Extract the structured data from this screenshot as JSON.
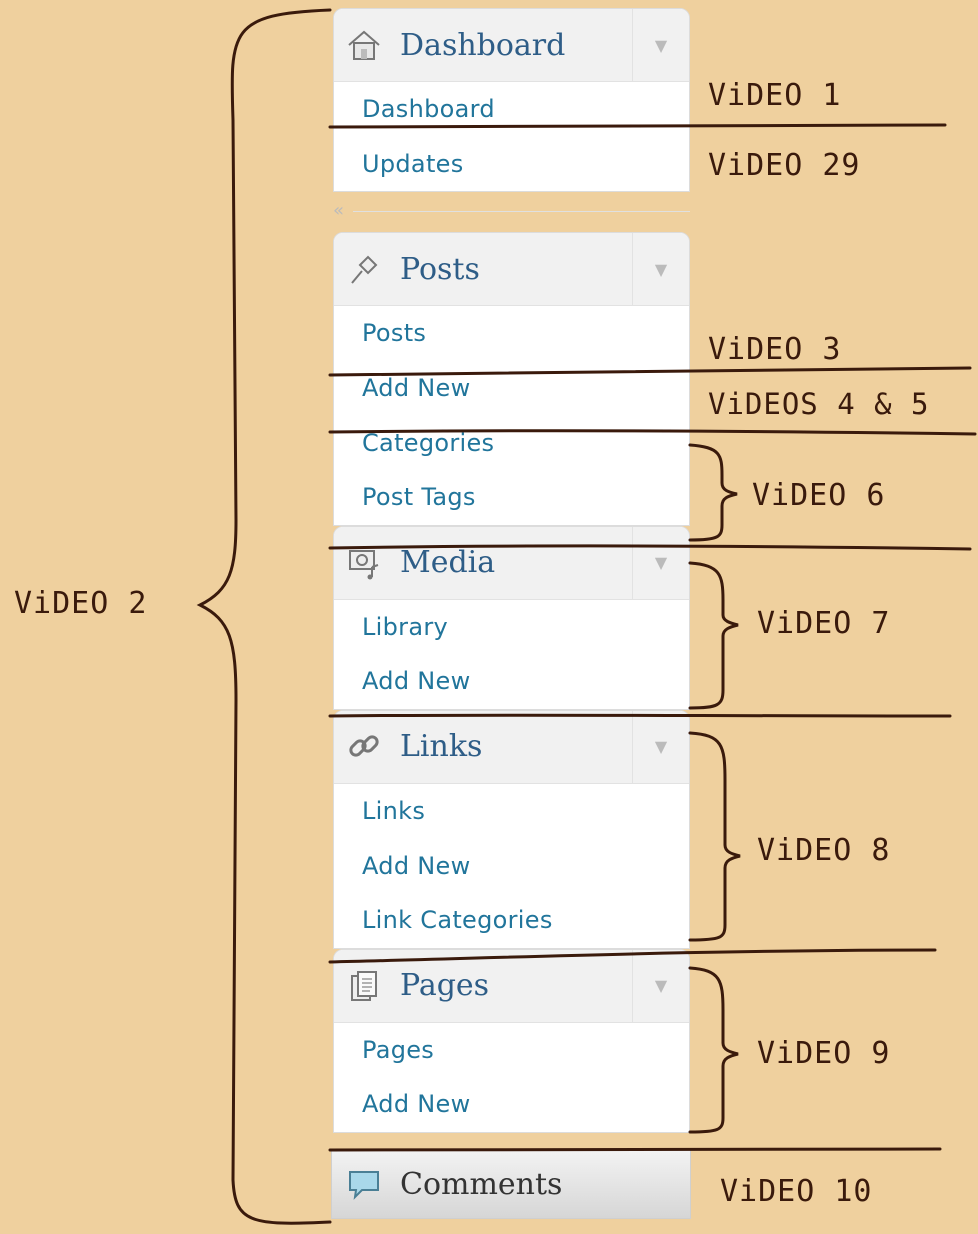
{
  "dashboard": {
    "title": "Dashboard",
    "items": [
      {
        "label": "Dashboard"
      },
      {
        "label": "Updates"
      }
    ]
  },
  "collapse_icon": "«",
  "posts": {
    "title": "Posts",
    "items": [
      {
        "label": "Posts"
      },
      {
        "label": "Add New"
      },
      {
        "label": "Categories"
      },
      {
        "label": "Post Tags"
      }
    ]
  },
  "media": {
    "title": "Media",
    "items": [
      {
        "label": "Library"
      },
      {
        "label": "Add New"
      }
    ]
  },
  "links": {
    "title": "Links",
    "items": [
      {
        "label": "Links"
      },
      {
        "label": "Add New"
      },
      {
        "label": "Link Categories"
      }
    ]
  },
  "pages": {
    "title": "Pages",
    "items": [
      {
        "label": "Pages"
      },
      {
        "label": "Add New"
      }
    ]
  },
  "comments": {
    "title": "Comments"
  },
  "toggle_icon": "▼",
  "annotations": {
    "a1": "ViDEO 1",
    "a29": "ViDEO 29",
    "a3": "ViDEO 3",
    "a45": "ViDEOS 4 & 5",
    "a6": "ViDEO 6",
    "a7": "ViDEO 7",
    "a8": "ViDEO 8",
    "a9": "ViDEO 9",
    "a10": "ViDEO 10",
    "a2": "ViDEO 2"
  },
  "colors": {
    "background": "#efd09e",
    "ink": "#3a1a0c",
    "link": "#21759b",
    "heading": "#2e5d87"
  }
}
